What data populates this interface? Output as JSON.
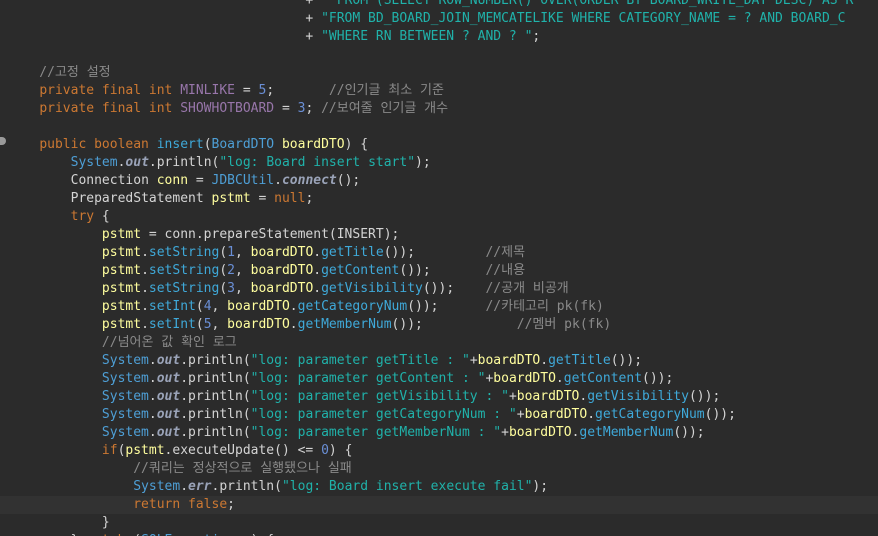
{
  "editor": {
    "file_language": "Java",
    "lines": [
      [
        [
          "t-plain",
          "                                      + "
        ],
        [
          "t-str",
          "\" FROM (SELECT ROW_NUMBER() OVER(ORDER BY BOARD_WRITE_DAY DESC) AS R"
        ]
      ],
      [
        [
          "t-plain",
          "                                      + "
        ],
        [
          "t-str",
          "\"FROM BD_BOARD_JOIN_MEMCATELIKE WHERE CATEGORY_NAME = ? AND BOARD_C"
        ]
      ],
      [
        [
          "t-plain",
          "                                      + "
        ],
        [
          "t-str",
          "\"WHERE RN BETWEEN ? AND ? \""
        ],
        [
          "t-plain",
          ";"
        ]
      ],
      [],
      [
        [
          "t-cmt",
          "    //고정 설정"
        ]
      ],
      [
        [
          "t-plain",
          "    "
        ],
        [
          "t-kw",
          "private final int "
        ],
        [
          "t-fld",
          "MINLIKE"
        ],
        [
          "t-plain",
          " = "
        ],
        [
          "t-num",
          "5"
        ],
        [
          "t-plain",
          ";       "
        ],
        [
          "t-cmt",
          "//인기글 최소 기준"
        ]
      ],
      [
        [
          "t-plain",
          "    "
        ],
        [
          "t-kw",
          "private final int "
        ],
        [
          "t-fld",
          "SHOWHOTBOARD"
        ],
        [
          "t-plain",
          " = "
        ],
        [
          "t-num",
          "3"
        ],
        [
          "t-plain",
          "; "
        ],
        [
          "t-cmt",
          "//보여줄 인기글 개수"
        ]
      ],
      [],
      [
        [
          "t-plain",
          "    "
        ],
        [
          "t-kw",
          "public boolean "
        ],
        [
          "t-fn",
          "insert"
        ],
        [
          "t-plain",
          "("
        ],
        [
          "t-cls",
          "BoardDTO "
        ],
        [
          "t-var",
          "boardDTO"
        ],
        [
          "t-plain",
          ") {"
        ]
      ],
      [
        [
          "t-plain",
          "        "
        ],
        [
          "t-cls",
          "System"
        ],
        [
          "t-plain",
          "."
        ],
        [
          "t-out",
          "out"
        ],
        [
          "t-plain",
          ".println("
        ],
        [
          "t-str",
          "\"log: Board insert start\""
        ],
        [
          "t-plain",
          ");"
        ]
      ],
      [
        [
          "t-plain",
          "        "
        ],
        [
          "t-type",
          "Connection "
        ],
        [
          "t-var",
          "conn"
        ],
        [
          "t-plain",
          " = "
        ],
        [
          "t-cls",
          "JDBCUtil"
        ],
        [
          "t-plain",
          "."
        ],
        [
          "t-out",
          "connect"
        ],
        [
          "t-plain",
          "();"
        ]
      ],
      [
        [
          "t-plain",
          "        "
        ],
        [
          "t-type",
          "PreparedStatement "
        ],
        [
          "t-var",
          "pstmt"
        ],
        [
          "t-plain",
          " = "
        ],
        [
          "t-kw",
          "null"
        ],
        [
          "t-plain",
          ";"
        ]
      ],
      [
        [
          "t-plain",
          "        "
        ],
        [
          "t-kw",
          "try"
        ],
        [
          "t-plain",
          " {"
        ]
      ],
      [
        [
          "t-plain",
          "            "
        ],
        [
          "t-var",
          "pstmt"
        ],
        [
          "t-plain",
          " = conn.prepareStatement(INSERT);"
        ]
      ],
      [
        [
          "t-plain",
          "            "
        ],
        [
          "t-var",
          "pstmt"
        ],
        [
          "t-plain",
          "."
        ],
        [
          "t-fn",
          "setString"
        ],
        [
          "t-plain",
          "("
        ],
        [
          "t-num",
          "1"
        ],
        [
          "t-plain",
          ", "
        ],
        [
          "t-var",
          "boardDTO"
        ],
        [
          "t-plain",
          "."
        ],
        [
          "t-fn",
          "getTitle"
        ],
        [
          "t-plain",
          "());         "
        ],
        [
          "t-cmt",
          "//제목"
        ]
      ],
      [
        [
          "t-plain",
          "            "
        ],
        [
          "t-var",
          "pstmt"
        ],
        [
          "t-plain",
          "."
        ],
        [
          "t-fn",
          "setString"
        ],
        [
          "t-plain",
          "("
        ],
        [
          "t-num",
          "2"
        ],
        [
          "t-plain",
          ", "
        ],
        [
          "t-var",
          "boardDTO"
        ],
        [
          "t-plain",
          "."
        ],
        [
          "t-fn",
          "getContent"
        ],
        [
          "t-plain",
          "());       "
        ],
        [
          "t-cmt",
          "//내용"
        ]
      ],
      [
        [
          "t-plain",
          "            "
        ],
        [
          "t-var",
          "pstmt"
        ],
        [
          "t-plain",
          "."
        ],
        [
          "t-fn",
          "setString"
        ],
        [
          "t-plain",
          "("
        ],
        [
          "t-num",
          "3"
        ],
        [
          "t-plain",
          ", "
        ],
        [
          "t-var",
          "boardDTO"
        ],
        [
          "t-plain",
          "."
        ],
        [
          "t-fn",
          "getVisibility"
        ],
        [
          "t-plain",
          "());    "
        ],
        [
          "t-cmt",
          "//공개 비공개"
        ]
      ],
      [
        [
          "t-plain",
          "            "
        ],
        [
          "t-var",
          "pstmt"
        ],
        [
          "t-plain",
          "."
        ],
        [
          "t-fn",
          "setInt"
        ],
        [
          "t-plain",
          "("
        ],
        [
          "t-num",
          "4"
        ],
        [
          "t-plain",
          ", "
        ],
        [
          "t-var",
          "boardDTO"
        ],
        [
          "t-plain",
          "."
        ],
        [
          "t-fn",
          "getCategoryNum"
        ],
        [
          "t-plain",
          "());      "
        ],
        [
          "t-cmt",
          "//카테고리 pk(fk)"
        ]
      ],
      [
        [
          "t-plain",
          "            "
        ],
        [
          "t-var",
          "pstmt"
        ],
        [
          "t-plain",
          "."
        ],
        [
          "t-fn",
          "setInt"
        ],
        [
          "t-plain",
          "("
        ],
        [
          "t-num",
          "5"
        ],
        [
          "t-plain",
          ", "
        ],
        [
          "t-var",
          "boardDTO"
        ],
        [
          "t-plain",
          "."
        ],
        [
          "t-fn",
          "getMemberNum"
        ],
        [
          "t-plain",
          "());            "
        ],
        [
          "t-cmt",
          "//멤버 pk(fk)"
        ]
      ],
      [
        [
          "t-cmt",
          "            //넘어온 값 확인 로그"
        ]
      ],
      [
        [
          "t-plain",
          "            "
        ],
        [
          "t-cls",
          "System"
        ],
        [
          "t-plain",
          "."
        ],
        [
          "t-out",
          "out"
        ],
        [
          "t-plain",
          ".println("
        ],
        [
          "t-str",
          "\"log: parameter getTitle : \""
        ],
        [
          "t-plain",
          "+"
        ],
        [
          "t-var",
          "boardDTO"
        ],
        [
          "t-plain",
          "."
        ],
        [
          "t-fn",
          "getTitle"
        ],
        [
          "t-plain",
          "());"
        ]
      ],
      [
        [
          "t-plain",
          "            "
        ],
        [
          "t-cls",
          "System"
        ],
        [
          "t-plain",
          "."
        ],
        [
          "t-out",
          "out"
        ],
        [
          "t-plain",
          ".println("
        ],
        [
          "t-str",
          "\"log: parameter getContent : \""
        ],
        [
          "t-plain",
          "+"
        ],
        [
          "t-var",
          "boardDTO"
        ],
        [
          "t-plain",
          "."
        ],
        [
          "t-fn",
          "getContent"
        ],
        [
          "t-plain",
          "());"
        ]
      ],
      [
        [
          "t-plain",
          "            "
        ],
        [
          "t-cls",
          "System"
        ],
        [
          "t-plain",
          "."
        ],
        [
          "t-out",
          "out"
        ],
        [
          "t-plain",
          ".println("
        ],
        [
          "t-str",
          "\"log: parameter getVisibility : \""
        ],
        [
          "t-plain",
          "+"
        ],
        [
          "t-var",
          "boardDTO"
        ],
        [
          "t-plain",
          "."
        ],
        [
          "t-fn",
          "getVisibility"
        ],
        [
          "t-plain",
          "());"
        ]
      ],
      [
        [
          "t-plain",
          "            "
        ],
        [
          "t-cls",
          "System"
        ],
        [
          "t-plain",
          "."
        ],
        [
          "t-out",
          "out"
        ],
        [
          "t-plain",
          ".println("
        ],
        [
          "t-str",
          "\"log: parameter getCategoryNum : \""
        ],
        [
          "t-plain",
          "+"
        ],
        [
          "t-var",
          "boardDTO"
        ],
        [
          "t-plain",
          "."
        ],
        [
          "t-fn",
          "getCategoryNum"
        ],
        [
          "t-plain",
          "());"
        ]
      ],
      [
        [
          "t-plain",
          "            "
        ],
        [
          "t-cls",
          "System"
        ],
        [
          "t-plain",
          "."
        ],
        [
          "t-out",
          "out"
        ],
        [
          "t-plain",
          ".println("
        ],
        [
          "t-str",
          "\"log: parameter getMemberNum : \""
        ],
        [
          "t-plain",
          "+"
        ],
        [
          "t-var",
          "boardDTO"
        ],
        [
          "t-plain",
          "."
        ],
        [
          "t-fn",
          "getMemberNum"
        ],
        [
          "t-plain",
          "());"
        ]
      ],
      [
        [
          "t-plain",
          "            "
        ],
        [
          "t-kw",
          "if"
        ],
        [
          "t-plain",
          "("
        ],
        [
          "t-var",
          "pstmt"
        ],
        [
          "t-plain",
          ".executeUpdate() <= "
        ],
        [
          "t-num",
          "0"
        ],
        [
          "t-plain",
          ") {"
        ]
      ],
      [
        [
          "t-cmt",
          "                //쿼리는 정상적으로 실행됐으나 실패"
        ]
      ],
      [
        [
          "t-plain",
          "                "
        ],
        [
          "t-cls",
          "System"
        ],
        [
          "t-plain",
          "."
        ],
        [
          "t-out",
          "err"
        ],
        [
          "t-plain",
          ".println("
        ],
        [
          "t-str",
          "\"log: Board insert execute fail\""
        ],
        [
          "t-plain",
          ");"
        ]
      ],
      [
        [
          "t-plain",
          "                "
        ],
        [
          "t-kw",
          "return false"
        ],
        [
          "t-plain",
          ";"
        ]
      ],
      [
        [
          "t-plain",
          "            }"
        ]
      ],
      [
        [
          "t-plain",
          "        } "
        ],
        [
          "t-kw",
          "catch"
        ],
        [
          "t-plain",
          " ("
        ],
        [
          "t-cls",
          "SQLException"
        ],
        [
          "t-plain",
          " e) {"
        ]
      ]
    ],
    "current_line": 28
  }
}
